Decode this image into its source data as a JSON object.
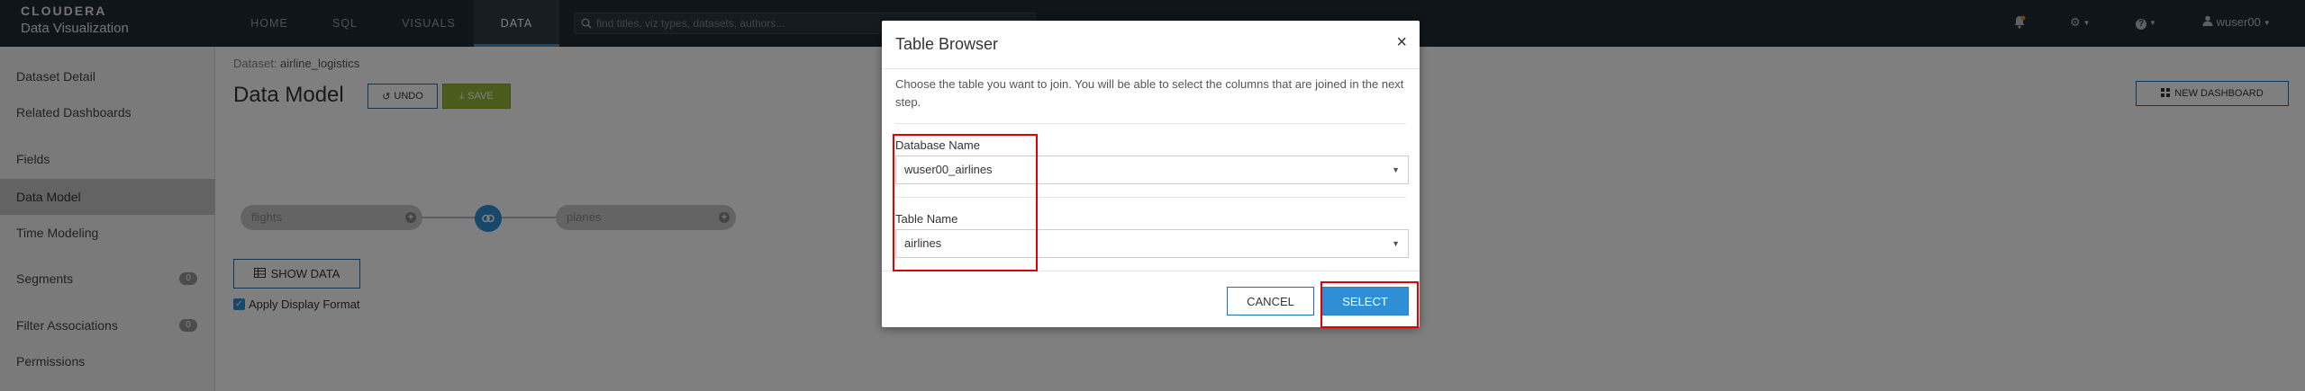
{
  "app": {
    "brand": "CLOUDERA",
    "product": "Data Visualization"
  },
  "nav": {
    "tabs": [
      {
        "label": "HOME"
      },
      {
        "label": "SQL"
      },
      {
        "label": "VISUALS"
      },
      {
        "label": "DATA",
        "active": true
      }
    ],
    "search_placeholder": "find titles, viz types, datasets, authors...",
    "user": "wuser00"
  },
  "sidebar": {
    "items": [
      {
        "label": "Dataset Detail"
      },
      {
        "label": "Related Dashboards"
      },
      {
        "label": "Fields"
      },
      {
        "label": "Data Model",
        "active": true
      },
      {
        "label": "Time Modeling"
      },
      {
        "label": "Segments",
        "badge": "0"
      },
      {
        "label": "Filter Associations",
        "badge": "0"
      },
      {
        "label": "Permissions"
      }
    ]
  },
  "main": {
    "dataset_label": "Dataset:",
    "dataset_name": "airline_logistics",
    "title": "Data Model",
    "undo_label": "UNDO",
    "save_label": "SAVE",
    "new_dashboard_label": "NEW DASHBOARD",
    "nodes": [
      "flights",
      "planes"
    ],
    "show_data_label": "SHOW DATA",
    "apply_display_format": "Apply Display Format"
  },
  "modal": {
    "title": "Table Browser",
    "close": "×",
    "description": "Choose the table you want to join. You will be able to select the columns that are joined in the next step.",
    "database_label": "Database Name",
    "database_value": "wuser00_airlines",
    "table_label": "Table Name",
    "table_value": "airlines",
    "cancel_label": "CANCEL",
    "select_label": "SELECT"
  },
  "colors": {
    "topbar": "#1f2a33",
    "accent": "#2f8fd6",
    "save": "#94b83a",
    "highlight": "#e00000"
  }
}
